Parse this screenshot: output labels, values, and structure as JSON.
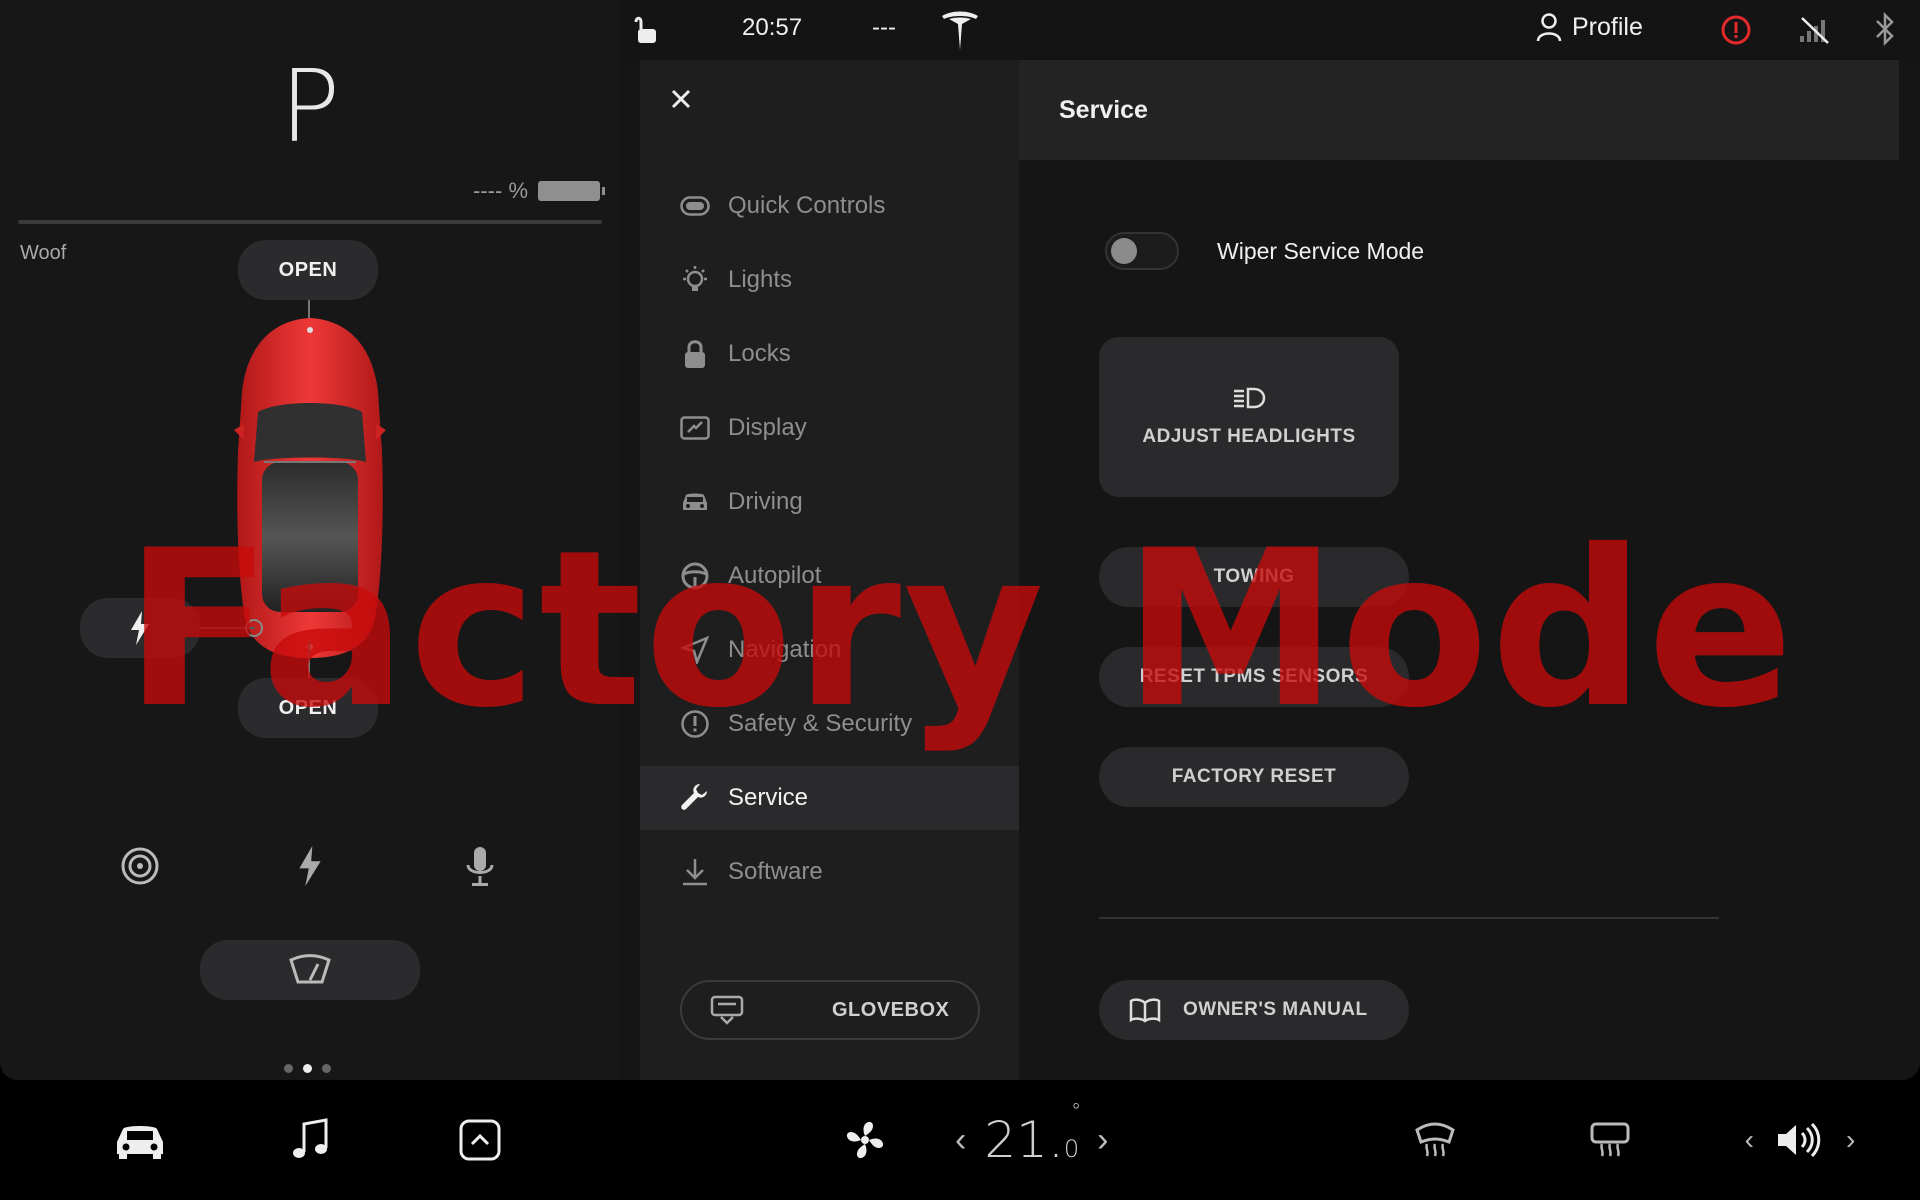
{
  "status_bar": {
    "time": "20:57",
    "temp_display": "---",
    "profile_label": "Profile"
  },
  "car_panel": {
    "gear": "P",
    "battery_text": "----",
    "battery_unit": "%",
    "car_name": "Woof",
    "frunk_label": "OPEN",
    "trunk_label": "OPEN",
    "page_dots": 3,
    "active_page": 2
  },
  "menu": {
    "items": [
      {
        "label": "Quick Controls",
        "icon": "toggle-icon"
      },
      {
        "label": "Lights",
        "icon": "lightbulb-icon"
      },
      {
        "label": "Locks",
        "icon": "lock-icon"
      },
      {
        "label": "Display",
        "icon": "display-icon"
      },
      {
        "label": "Driving",
        "icon": "car-icon"
      },
      {
        "label": "Autopilot",
        "icon": "steering-wheel-icon"
      },
      {
        "label": "Navigation",
        "icon": "navigation-icon"
      },
      {
        "label": "Safety & Security",
        "icon": "alert-icon"
      },
      {
        "label": "Service",
        "icon": "wrench-icon"
      },
      {
        "label": "Software",
        "icon": "download-icon"
      }
    ],
    "active_item": "Service",
    "glovebox_label": "GLOVEBOX"
  },
  "content": {
    "title": "Service",
    "wiper_toggle_label": "Wiper Service Mode",
    "wiper_toggle_on": false,
    "adjust_headlights_label": "ADJUST HEADLIGHTS",
    "towing_label": "TOWING",
    "reset_tpms_label": "RESET TPMS SENSORS",
    "factory_reset_label": "FACTORY RESET",
    "owners_manual_label": "OWNER'S MANUAL"
  },
  "watermark": "Factory Mode",
  "climate": {
    "temp_whole": "21.",
    "temp_decimal": "0",
    "degree_symbol": "°"
  },
  "colors": {
    "accent_red": "#c80a0a",
    "background": "#151516",
    "menu_bg": "#1e1e1f",
    "alert_red": "#e22a2a"
  }
}
